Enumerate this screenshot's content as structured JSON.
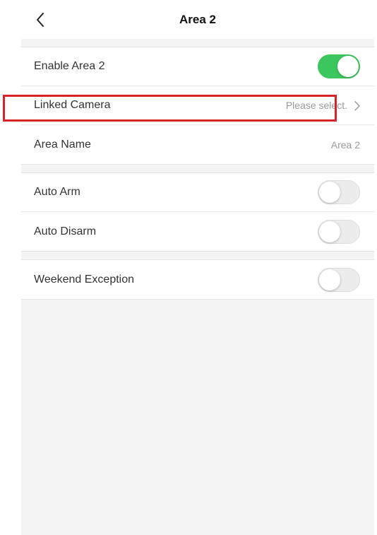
{
  "header": {
    "title": "Area 2",
    "back_icon": "chevron-left-icon"
  },
  "settings": {
    "enable_area": {
      "label": "Enable Area 2",
      "toggle_on": true
    },
    "linked_camera": {
      "label": "Linked Camera",
      "value": "Please select.",
      "icon": "chevron-right-icon"
    },
    "area_name": {
      "label": "Area Name",
      "value": "Area 2"
    },
    "auto_arm": {
      "label": "Auto Arm",
      "toggle_on": false
    },
    "auto_disarm": {
      "label": "Auto Disarm",
      "toggle_on": false
    },
    "weekend_exception": {
      "label": "Weekend Exception",
      "toggle_on": false
    }
  },
  "colors": {
    "toggle_on": "#3cc65e",
    "toggle_off": "#ececec",
    "highlight": "#d9232a",
    "background": "#f4f4f4"
  }
}
